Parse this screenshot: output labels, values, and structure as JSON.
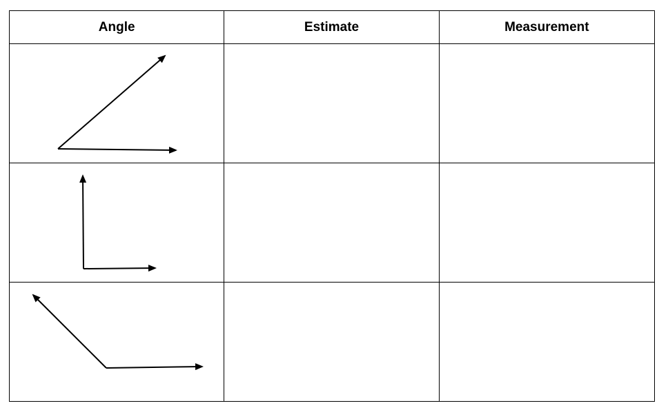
{
  "table": {
    "headers": {
      "angle": "Angle",
      "estimate": "Estimate",
      "measurement": "Measurement"
    },
    "rows": [
      {
        "angle_figure": "acute-angle-icon",
        "estimate": "",
        "measurement": ""
      },
      {
        "angle_figure": "right-angle-icon",
        "estimate": "",
        "measurement": ""
      },
      {
        "angle_figure": "obtuse-angle-icon",
        "estimate": "",
        "measurement": ""
      }
    ]
  },
  "colors": {
    "line": "#000000",
    "background": "#ffffff"
  }
}
